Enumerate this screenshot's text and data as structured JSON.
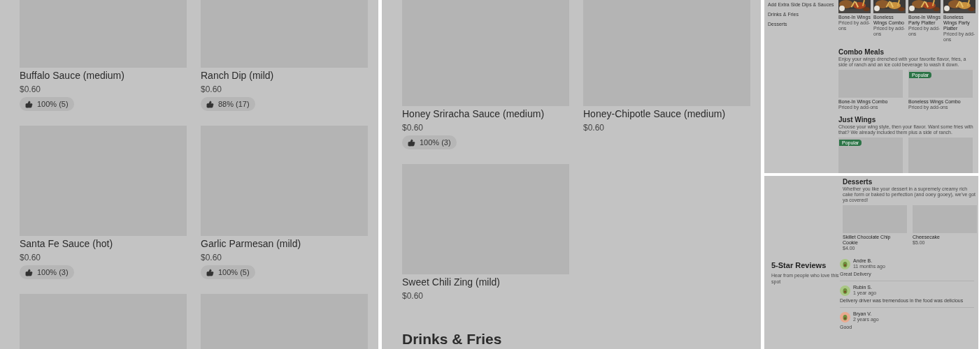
{
  "sauces_left": {
    "cards": [
      {
        "kind": "item",
        "name": "Buffalo Sauce (medium)",
        "price": "$0.60",
        "rating": "100% (5)"
      },
      {
        "kind": "item",
        "name": "Ranch Dip (mild)",
        "price": "$0.60",
        "rating": "88% (17)"
      },
      {
        "kind": "item",
        "name": "Santa Fe Sauce (hot)",
        "price": "$0.60",
        "rating": "100% (3)"
      },
      {
        "kind": "item",
        "name": "Garlic Parmesan (mild)",
        "price": "$0.60",
        "rating": "100% (5)"
      },
      {
        "kind": "image_only"
      },
      {
        "kind": "image_only"
      }
    ]
  },
  "sauces_right": {
    "cards": [
      {
        "kind": "item",
        "name": "Honey Sriracha Sauce (medium)",
        "price": "$0.60",
        "rating": "100% (3)"
      },
      {
        "kind": "item",
        "name": "Honey-Chipotle Sauce (medium)",
        "price": "$0.60"
      },
      {
        "kind": "item",
        "name": "Sweet Chili Zing (mild)",
        "price": "$0.60"
      }
    ],
    "next_section": {
      "title": "Drinks & Fries"
    }
  },
  "menu_overview": {
    "sidebar": {
      "items": [
        {
          "label": "Add Extra Side Dips & Sauces",
          "selected": false
        },
        {
          "label": "Drinks & Fries",
          "selected": false
        },
        {
          "label": "Desserts",
          "selected": false
        }
      ]
    },
    "featured": [
      {
        "name": "Bone-In Wings",
        "note": "Priced by add-ons"
      },
      {
        "name": "Boneless Wings Combo",
        "note": "Priced by add-ons"
      },
      {
        "name": "Bone-In Wings Party Platter",
        "note": "Priced by add-ons"
      },
      {
        "name": "Boneless Wings Party Platter",
        "note": "Priced by add-ons"
      }
    ],
    "sections": [
      {
        "title": "Combo Meals",
        "description": "Enjoy your wings drenched with your favorite flavor, fries, a side of ranch and an ice cold beverage to wash it down.",
        "cards": [
          {
            "name": "Bone-In Wings Combo",
            "note": "Priced by add-ons"
          },
          {
            "name": "Boneless Wings Combo",
            "note": "Priced by add-ons",
            "badge": "Popular"
          }
        ]
      },
      {
        "title": "Just Wings",
        "description": "Choose your wing style, then your flavor. Want some fries with that? We already included them plus a side of ranch.",
        "cards": [
          {
            "kind": "image_only",
            "badge": "Popular"
          },
          {
            "kind": "image_only"
          }
        ]
      }
    ]
  },
  "desserts_reviews": {
    "desserts": {
      "title": "Desserts",
      "description": "Whether you like your dessert in a supremely creamy rich cake form or baked to perfection (and ooey gooey), we've got ya covered!",
      "cards": [
        {
          "name": "Skillet Chocolate Chip Cookie",
          "price": "$4.00"
        },
        {
          "name": "Cheesecake",
          "price": "$5.00"
        }
      ]
    },
    "reviews": {
      "title": "5-Star Reviews",
      "subtitle": "Hear from people who love this spot",
      "items": [
        {
          "author": "Andre B.",
          "time": "11 months ago",
          "text": "Great Delivery",
          "color": "#a9c784"
        },
        {
          "author": "Rubin S.",
          "time": "1 year ago",
          "text": "Delivery driver was tremendous in the food was delicious",
          "color": "#a9c784"
        },
        {
          "author": "Bryan V.",
          "time": "2 years ago",
          "text": "Good",
          "color": "#e9a98f"
        }
      ]
    }
  }
}
